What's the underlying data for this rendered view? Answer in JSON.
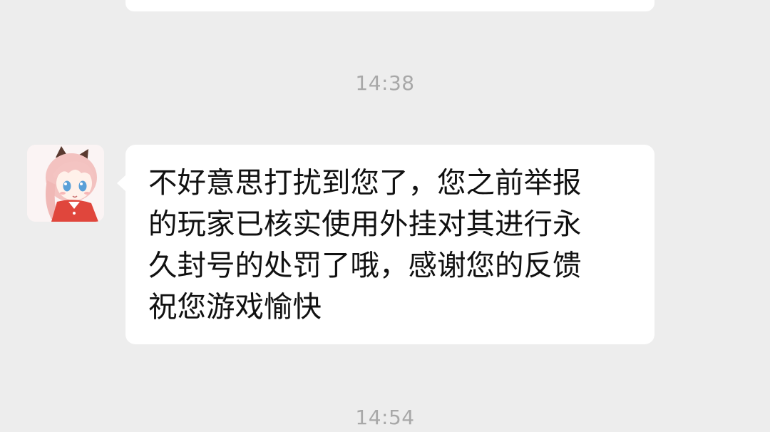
{
  "chat": {
    "timestamps": [
      "14:38",
      "14:54"
    ],
    "message": {
      "lines": [
        "不好意思打扰到您了，您之前举报",
        "的玩家已核实使用外挂对其进行永",
        "久封号的处罚了哦，感谢您的反馈",
        "祝您游戏愉快"
      ]
    }
  },
  "colors": {
    "background": "#ededed",
    "bubble": "#ffffff",
    "timestamp": "#a8a8a8",
    "text": "#111111"
  }
}
